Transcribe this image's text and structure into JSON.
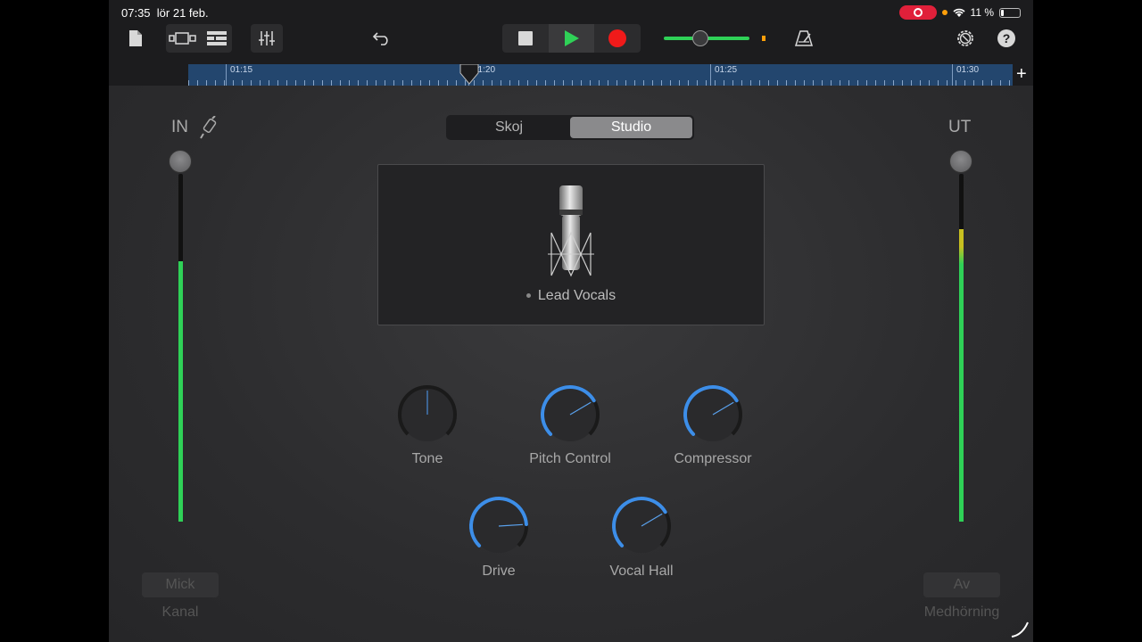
{
  "status": {
    "time": "07:35",
    "date": "lör 21 feb.",
    "battery": "11 %"
  },
  "toolbar": {
    "icons": [
      "document-icon",
      "tracks-view-icon",
      "list-view-icon",
      "mixer-icon",
      "undo-icon",
      "stop-icon",
      "play-icon",
      "record-icon",
      "metronome-icon",
      "settings-icon",
      "help-icon"
    ],
    "help_label": "?"
  },
  "ruler": {
    "labels": [
      "01:15",
      "01:20",
      "01:25",
      "01:30"
    ],
    "add_label": "+"
  },
  "mode_tabs": [
    {
      "label": "Skoj",
      "active": false
    },
    {
      "label": "Studio",
      "active": true
    }
  ],
  "preset": {
    "name": "Lead Vocals"
  },
  "input": {
    "label": "IN",
    "level": 0.75,
    "button": "Mick",
    "caption": "Kanal"
  },
  "output": {
    "label": "UT",
    "level": 0.84,
    "button": "Av",
    "caption": "Medhörning"
  },
  "knobs": [
    {
      "name": "Tone",
      "value": 0.5,
      "active": false
    },
    {
      "name": "Pitch Control",
      "value": 0.72,
      "active": true
    },
    {
      "name": "Compressor",
      "value": 0.72,
      "active": true
    },
    {
      "name": "Drive",
      "value": 0.82,
      "active": true
    },
    {
      "name": "Vocal Hall",
      "value": 0.72,
      "active": true
    }
  ],
  "colors": {
    "accent": "#3d8ee8",
    "meter_green": "#2fd157",
    "record": "#f01a1a",
    "ruler": "#23466e"
  }
}
